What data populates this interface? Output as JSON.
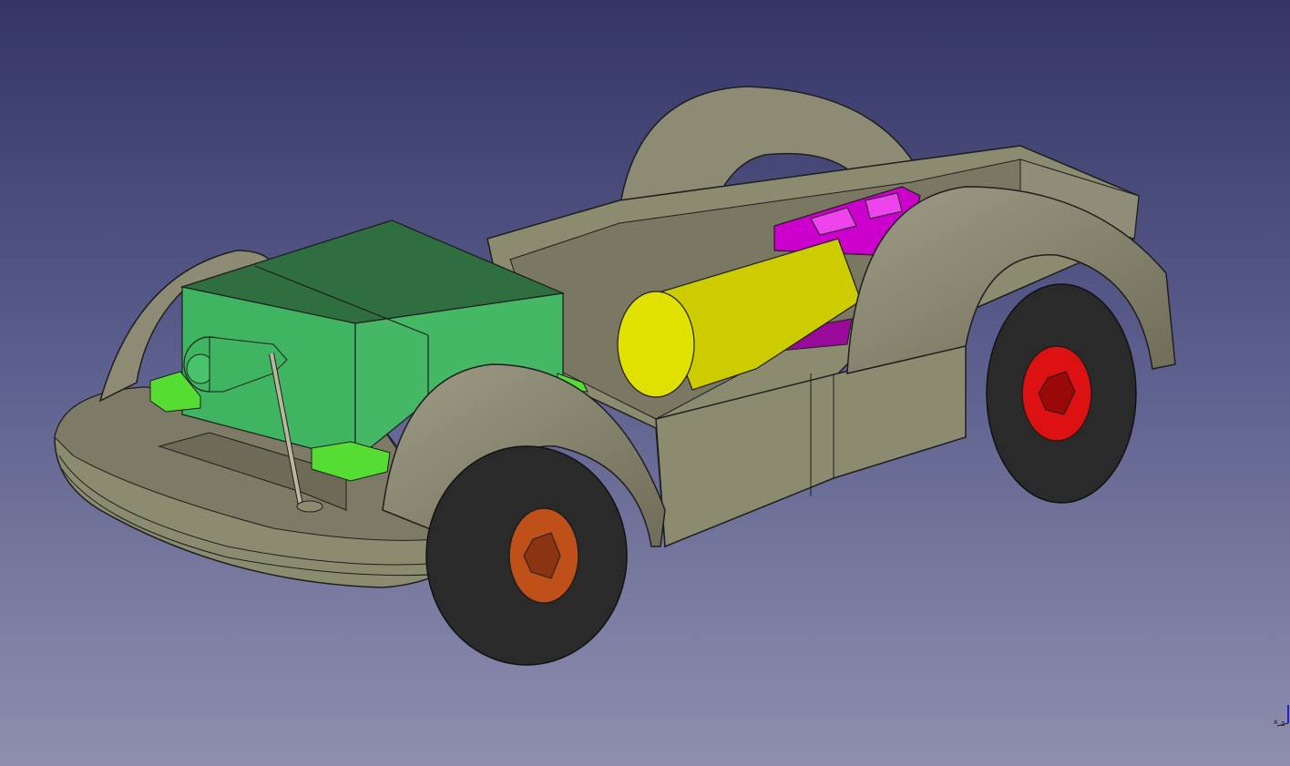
{
  "viewer": {
    "background_top": "#343566",
    "background_bottom": "#8e8fae",
    "navigation_cube_axes": {
      "x": "x",
      "z": "z"
    }
  },
  "model": {
    "parts": [
      {
        "name": "chassis-frame",
        "color": "#8b8b70"
      },
      {
        "name": "battery-box",
        "color": "#3fb562"
      },
      {
        "name": "servo-mounts",
        "color": "#55dd33"
      },
      {
        "name": "drive-motor",
        "color": "#cccc00"
      },
      {
        "name": "gear-block",
        "color": "#cc00cc"
      },
      {
        "name": "front-wheel-rim",
        "color": "#c0501a"
      },
      {
        "name": "rear-wheel-rim",
        "color": "#dd1111"
      },
      {
        "name": "tires",
        "color": "#2a2a2a"
      }
    ]
  }
}
